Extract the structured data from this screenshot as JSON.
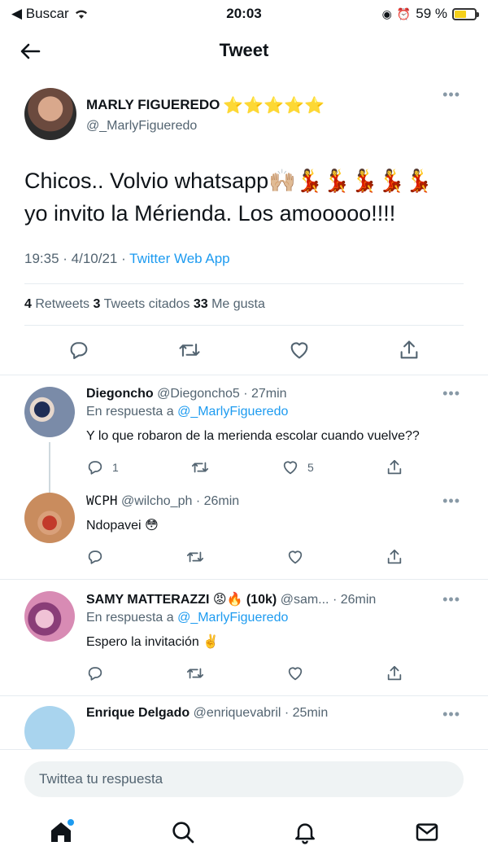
{
  "status": {
    "back_app": "◀ Buscar",
    "time": "20:03",
    "battery_text": "59 %",
    "battery_level": 0.59
  },
  "header": {
    "title": "Tweet"
  },
  "main_tweet": {
    "name": "MARLY FIGUEREDO",
    "stars": "⭐⭐⭐⭐⭐",
    "handle": "@_MarlyFigueredo",
    "body_line1": "Chicos.. Volvio whatsapp🙌🏼💃💃💃💃💃",
    "body_line2": "yo invito la Mérienda. Los amooooo!!!!",
    "time": "19:35 · 4/10/21 · ",
    "source": "Twitter Web App",
    "retweets": "4",
    "retweets_label": " Retweets ",
    "quotes": "3",
    "quotes_label": " Tweets citados ",
    "likes": "33",
    "likes_label": " Me gusta"
  },
  "replies": [
    {
      "name": "Diegoncho",
      "handle_time": " @Diegoncho5 · 27min",
      "reply_to_prefix": "En respuesta a ",
      "reply_to_handle": "@_MarlyFigueredo",
      "text": "Y lo que robaron de la merienda escolar cuando vuelve??",
      "reply_count": "1",
      "retweet_count": "",
      "like_count": "5"
    },
    {
      "name": "WCPH",
      "handle_time": " @wilcho_ph · 26min",
      "text": "Ndopavei 😳",
      "reply_count": "",
      "retweet_count": "",
      "like_count": ""
    },
    {
      "name": "SAMY MATTERAZZI 😡🔥 (10k)",
      "handle_time": " @sam... · 26min",
      "reply_to_prefix": "En respuesta a ",
      "reply_to_handle": "@_MarlyFigueredo",
      "text": "Espero la invitación ✌️",
      "reply_count": "",
      "retweet_count": "",
      "like_count": ""
    },
    {
      "name": "Enrique Delgado",
      "handle_time": " @enriquevabril · 25min"
    }
  ],
  "reply_box": {
    "placeholder": "Twittea tu respuesta"
  },
  "colors": {
    "accent": "#1d9bf0",
    "stars": "#f5c518",
    "muted": "#536471"
  },
  "icons": [
    "back-arrow-icon",
    "reply-icon",
    "retweet-icon",
    "like-icon",
    "share-icon",
    "home-icon",
    "search-icon",
    "notifications-icon",
    "messages-icon"
  ]
}
